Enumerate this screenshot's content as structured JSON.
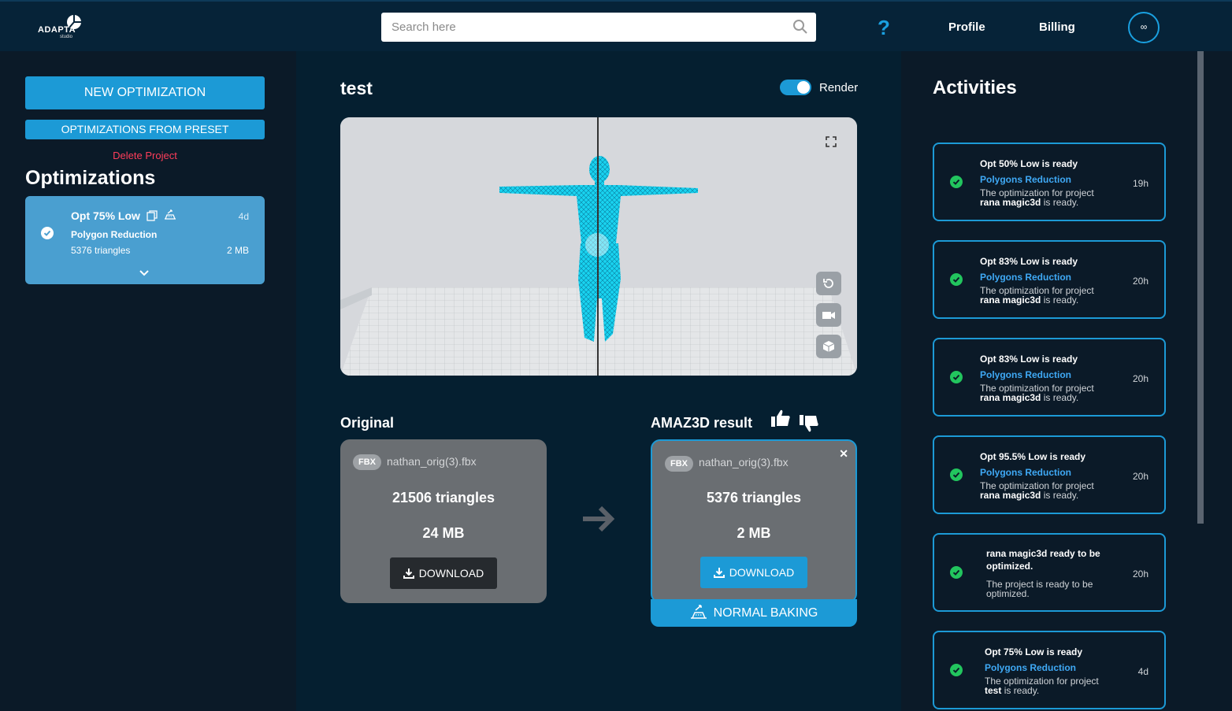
{
  "header": {
    "logo_text": "ADAPTA",
    "logo_sub": "studio",
    "search_placeholder": "Search here",
    "help": "?",
    "profile": "Profile",
    "billing": "Billing",
    "avatar": "∞"
  },
  "sidebar": {
    "new_optimization": "NEW OPTIMIZATION",
    "optimizations_from_preset": "OPTIMIZATIONS FROM PRESET",
    "delete_project": "Delete Project",
    "title": "Optimizations",
    "card": {
      "name": "Opt 75% Low",
      "age": "4d",
      "type": "Polygon Reduction",
      "triangles": "5376 triangles",
      "size": "2 MB"
    }
  },
  "main": {
    "project_title": "test",
    "render_label": "Render",
    "render_on": true,
    "original_label": "Original",
    "result_label": "AMAZ3D result",
    "original": {
      "badge": "FBX",
      "file": "nathan_orig(3).fbx",
      "triangles": "21506 triangles",
      "size": "24 MB",
      "download": "DOWNLOAD"
    },
    "result": {
      "badge": "FBX",
      "file": "nathan_orig(3).fbx",
      "triangles": "5376 triangles",
      "size": "2 MB",
      "download": "DOWNLOAD",
      "close": "✕"
    },
    "baking": "NORMAL BAKING"
  },
  "activities": {
    "title": "Activities",
    "items": [
      {
        "title": "Opt 50% Low is ready",
        "subtitle": "Polygons Reduction",
        "desc_pre": "The optimization for project",
        "project": "rana magic3d",
        "desc_post": "is ready.",
        "age": "19h"
      },
      {
        "title": "Opt 83% Low is ready",
        "subtitle": "Polygons Reduction",
        "desc_pre": "The optimization for project",
        "project": "rana magic3d",
        "desc_post": "is ready.",
        "age": "20h"
      },
      {
        "title": "Opt 83% Low is ready",
        "subtitle": "Polygons Reduction",
        "desc_pre": "The optimization for project",
        "project": "rana magic3d",
        "desc_post": "is ready.",
        "age": "20h"
      },
      {
        "title": "Opt 95.5% Low is ready",
        "subtitle": "Polygons Reduction",
        "desc_pre": "The optimization for project",
        "project": "rana magic3d",
        "desc_post": "is ready.",
        "age": "20h"
      },
      {
        "title": "rana magic3d ready to be optimized.",
        "subtitle": "",
        "desc_pre": "The project is ready to be optimized.",
        "project": "",
        "desc_post": "",
        "age": "20h"
      },
      {
        "title": "Opt 75% Low is ready",
        "subtitle": "Polygons Reduction",
        "desc_pre": "The optimization for project",
        "project": "test",
        "desc_post": "is ready.",
        "age": "4d"
      }
    ]
  },
  "colors": {
    "accent": "#1c9ad6",
    "success": "#22c55e",
    "danger": "#ff3d5a",
    "mesh": "#19d3f0"
  }
}
